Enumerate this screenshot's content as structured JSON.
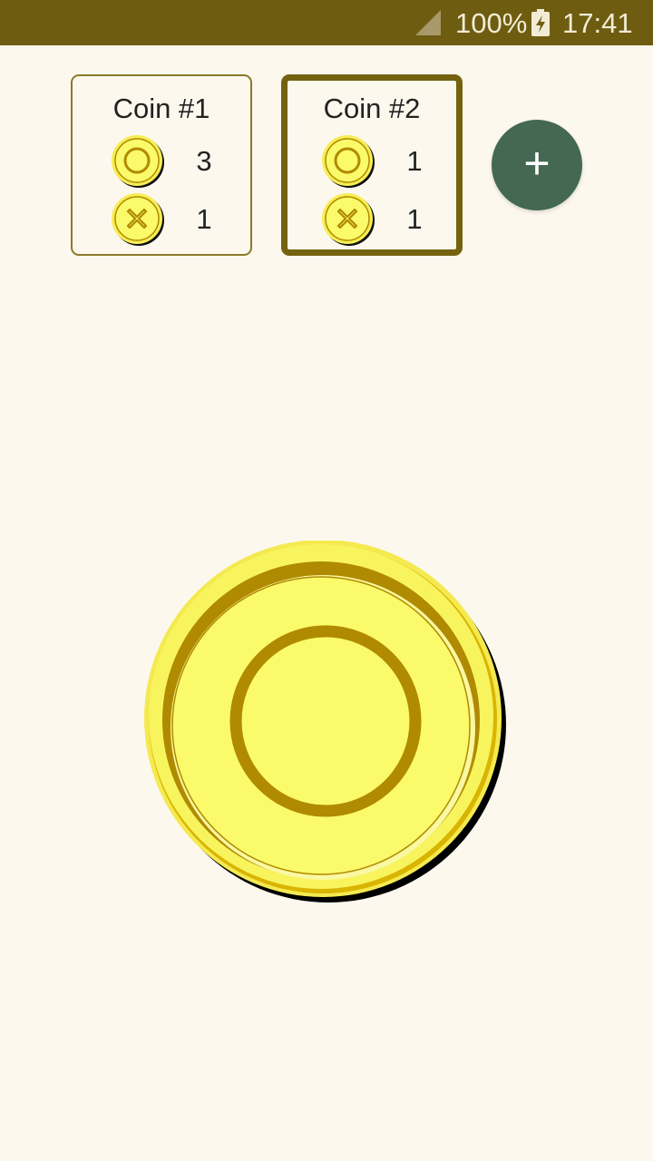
{
  "status_bar": {
    "battery": "100%",
    "time": "17:41"
  },
  "coins": [
    {
      "title": "Coin #1",
      "heads_count": "3",
      "tails_count": "1",
      "selected": false
    },
    {
      "title": "Coin #2",
      "heads_count": "1",
      "tails_count": "1",
      "selected": true
    }
  ],
  "add_button": {
    "label": "+"
  },
  "current_coin": {
    "face": "heads-o-icon"
  },
  "colors": {
    "status_bar": "#6e5c10",
    "background": "#fdf8ee",
    "coin_face": "#fafa6a",
    "coin_rim": "#b08a00",
    "add_button": "#446852"
  }
}
